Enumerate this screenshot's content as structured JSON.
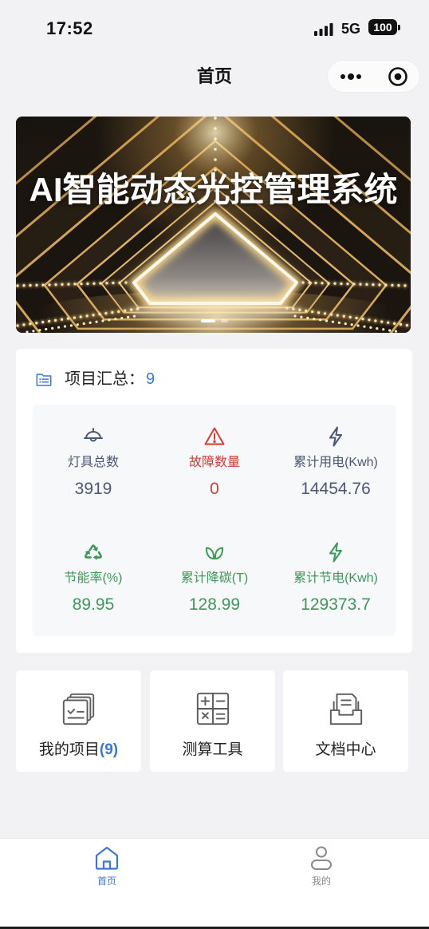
{
  "status_bar": {
    "time": "17:52",
    "network": "5G",
    "battery": "100",
    "signal_icon": "signal-bars-icon"
  },
  "nav": {
    "title": "首页",
    "more_icon": "more-dots-icon",
    "close_icon": "target-icon"
  },
  "banner": {
    "title": "AI智能动态光控管理系统",
    "indicator": {
      "count": 2,
      "active": 0
    }
  },
  "summary": {
    "icon": "list-folder-icon",
    "title": "项目汇总：",
    "count": "9",
    "stats": [
      {
        "icon": "lamp-icon",
        "label": "灯具总数",
        "value": "3919",
        "color": "#4c5775"
      },
      {
        "icon": "warning-icon",
        "label": "故障数量",
        "value": "0",
        "color": "#d33b34"
      },
      {
        "icon": "lightning-icon",
        "label": "累计用电(Kwh)",
        "value": "14454.76",
        "color": "#4c5775"
      },
      {
        "icon": "recycle-icon",
        "label": "节能率(%)",
        "value": "89.95",
        "color": "#3e9858"
      },
      {
        "icon": "leaf-icon",
        "label": "累计降碳(T)",
        "value": "128.99",
        "color": "#3e9858"
      },
      {
        "icon": "lightning-icon",
        "label": "累计节电(Kwh)",
        "value": "129373.7",
        "color": "#3e9858"
      }
    ]
  },
  "shortcuts": [
    {
      "icon": "projects-icon",
      "label": "我的项目",
      "badge": "(9)"
    },
    {
      "icon": "calculator-icon",
      "label": "测算工具"
    },
    {
      "icon": "document-tray-icon",
      "label": "文档中心"
    }
  ],
  "tabbar": [
    {
      "icon": "home-icon",
      "label": "首页",
      "active": true
    },
    {
      "icon": "user-icon",
      "label": "我的",
      "active": false
    }
  ],
  "colors": {
    "accent": "#3a78d6",
    "danger": "#d33b34",
    "success": "#3e9858",
    "slate": "#4c5775",
    "inactive": "#8a8a8a"
  }
}
